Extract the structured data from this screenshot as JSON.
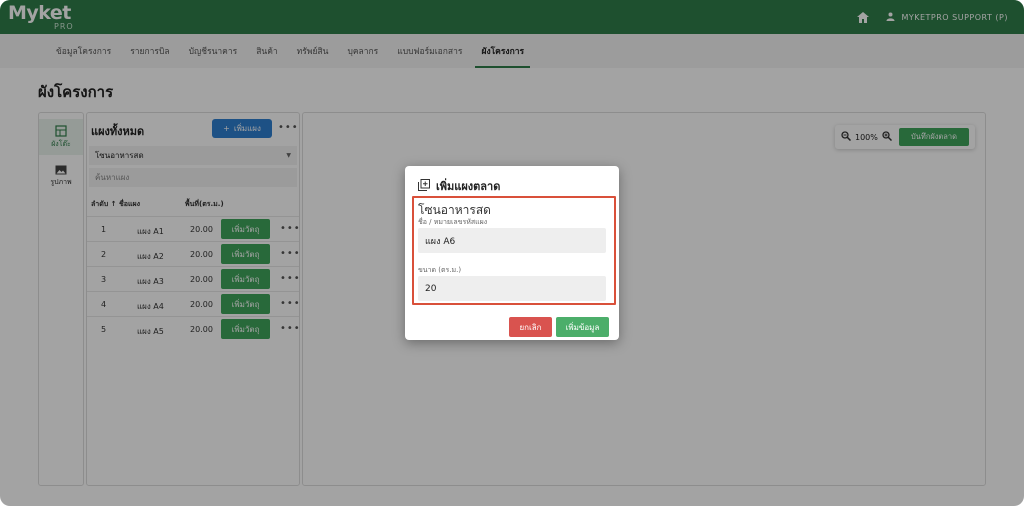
{
  "brand": {
    "logo_text": "Myket",
    "logo_sub": "PRO"
  },
  "header": {
    "user_label": "MYKETPRO SUPPORT (P)"
  },
  "nav": {
    "tabs": [
      "ข้อมูลโครงการ",
      "รายการบิล",
      "บัญชีรนาคาร",
      "สินค้า",
      "ทรัพย์สิน",
      "บุคลากร",
      "แบบฟอร์มเอกสาร",
      "ผังโครงการ"
    ],
    "active_index": 7
  },
  "page": {
    "title": "ผังโครงการ"
  },
  "rail": {
    "items": [
      {
        "label": "ผังโต๊ะ",
        "icon": "layout-icon"
      },
      {
        "label": "รูปภาพ",
        "icon": "image-icon"
      }
    ]
  },
  "list": {
    "title": "แผงทั้งหมด",
    "add_label": "เพิ่มแผง",
    "zone_selected": "โซนอาหารสด",
    "search_placeholder": "ค้นหาแผง",
    "columns": {
      "order": "ลำดับ",
      "name": "ชื่อแผง",
      "area": "พื้นที่(ตร.ม.)"
    },
    "action_label": "เพิ่มวัตถุ",
    "rows": [
      {
        "order": "1",
        "name": "แผง A1",
        "area": "20.00"
      },
      {
        "order": "2",
        "name": "แผง A2",
        "area": "20.00"
      },
      {
        "order": "3",
        "name": "แผง A3",
        "area": "20.00"
      },
      {
        "order": "4",
        "name": "แผง A4",
        "area": "20.00"
      },
      {
        "order": "5",
        "name": "แผง A5",
        "area": "20.00"
      }
    ]
  },
  "canvas": {
    "zoom": "100%",
    "save_label": "บันทึกผังตลาด"
  },
  "modal": {
    "title": "เพิ่มแผงตลาด",
    "zone": "โซนอาหารสด",
    "name_label": "ชื่อ / หมายเลขรหัสแผง",
    "name_value": "แผง A6",
    "size_label": "ขนาด (ตร.ม.)",
    "size_value": "20",
    "cancel_label": "ยกเลิก",
    "submit_label": "เพิ่มข้อมูล"
  },
  "colors": {
    "brand": "#2f7d4a",
    "primary": "#2e7fd1",
    "success": "#3fa55c",
    "danger": "#d9534f",
    "highlight": "#d9503a"
  }
}
